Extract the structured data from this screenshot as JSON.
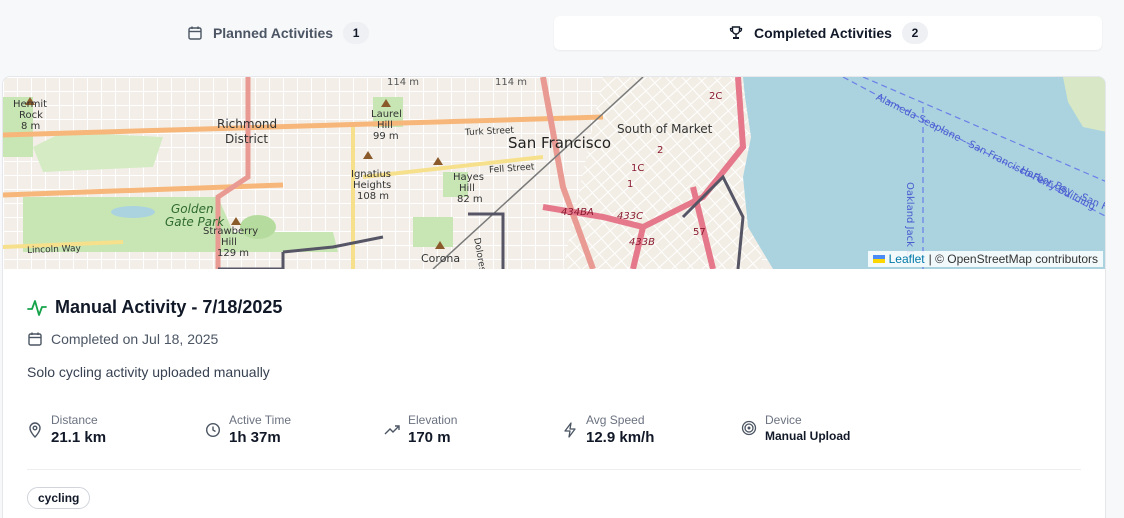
{
  "tabs": [
    {
      "label": "Planned Activities",
      "count": "1",
      "icon": "calendar-icon",
      "active": false
    },
    {
      "label": "Completed Activities",
      "count": "2",
      "icon": "trophy-icon",
      "active": true
    }
  ],
  "map": {
    "labels": {
      "richmond": "Richmond",
      "district": "District",
      "san_francisco": "San Francisco",
      "south_of_market": "South of Market",
      "golden": "Golden",
      "gate_park": "Gate Park",
      "strawberry": "Strawberry",
      "hill": "Hill",
      "hill_129": "129 m",
      "laurel": "Laurel",
      "laurel_hill": "Hill",
      "laurel_99": "99 m",
      "ignatius": "Ignatius",
      "heights": "Heights",
      "heights_108": "108 m",
      "hayes": "Hayes",
      "hayes_hill": "Hill",
      "hayes_82": "82 m",
      "hermit": "Hermit",
      "rock": "Rock",
      "rock_8": "8 m",
      "corona": "Corona",
      "turk_street": "Turk Street",
      "fell_street": "Fell Street",
      "lincoln_way": "Lincoln Way",
      "dolores": "Dolores Stre",
      "ferry": "Alameda Seaplane - San Francisco Ferry Building",
      "harbor": "Harbor Bay - San Fra",
      "oakland": "Oakland Jack Li",
      "m114a": "114 m",
      "m114b": "114 m",
      "r434ba": "434BA",
      "r433c": "433C",
      "r433b": "433B",
      "r57": "57",
      "r2": "2",
      "r1c": "1C",
      "r1": "1",
      "r2c": "2C"
    },
    "attribution_link": "Leaflet",
    "attribution_text": "| © OpenStreetMap contributors"
  },
  "activity": {
    "title": "Manual Activity - 7/18/2025",
    "icon": "activity-pulse-icon",
    "completed": "Completed on Jul 18, 2025",
    "description": "Solo cycling activity uploaded manually",
    "stats": [
      {
        "label": "Distance",
        "value": "21.1 km",
        "icon": "map-pin-icon"
      },
      {
        "label": "Active Time",
        "value": "1h 37m",
        "icon": "clock-icon"
      },
      {
        "label": "Elevation",
        "value": "170 m",
        "icon": "trending-up-icon"
      },
      {
        "label": "Avg Speed",
        "value": "12.9 km/h",
        "icon": "lightning-icon"
      },
      {
        "label": "Device",
        "value": "Manual Upload",
        "icon": "target-icon"
      }
    ],
    "tags": [
      "cycling"
    ]
  },
  "colors": {
    "accent_green": "#16a34a",
    "water": "#aad3df",
    "park": "#c8e6b4"
  }
}
